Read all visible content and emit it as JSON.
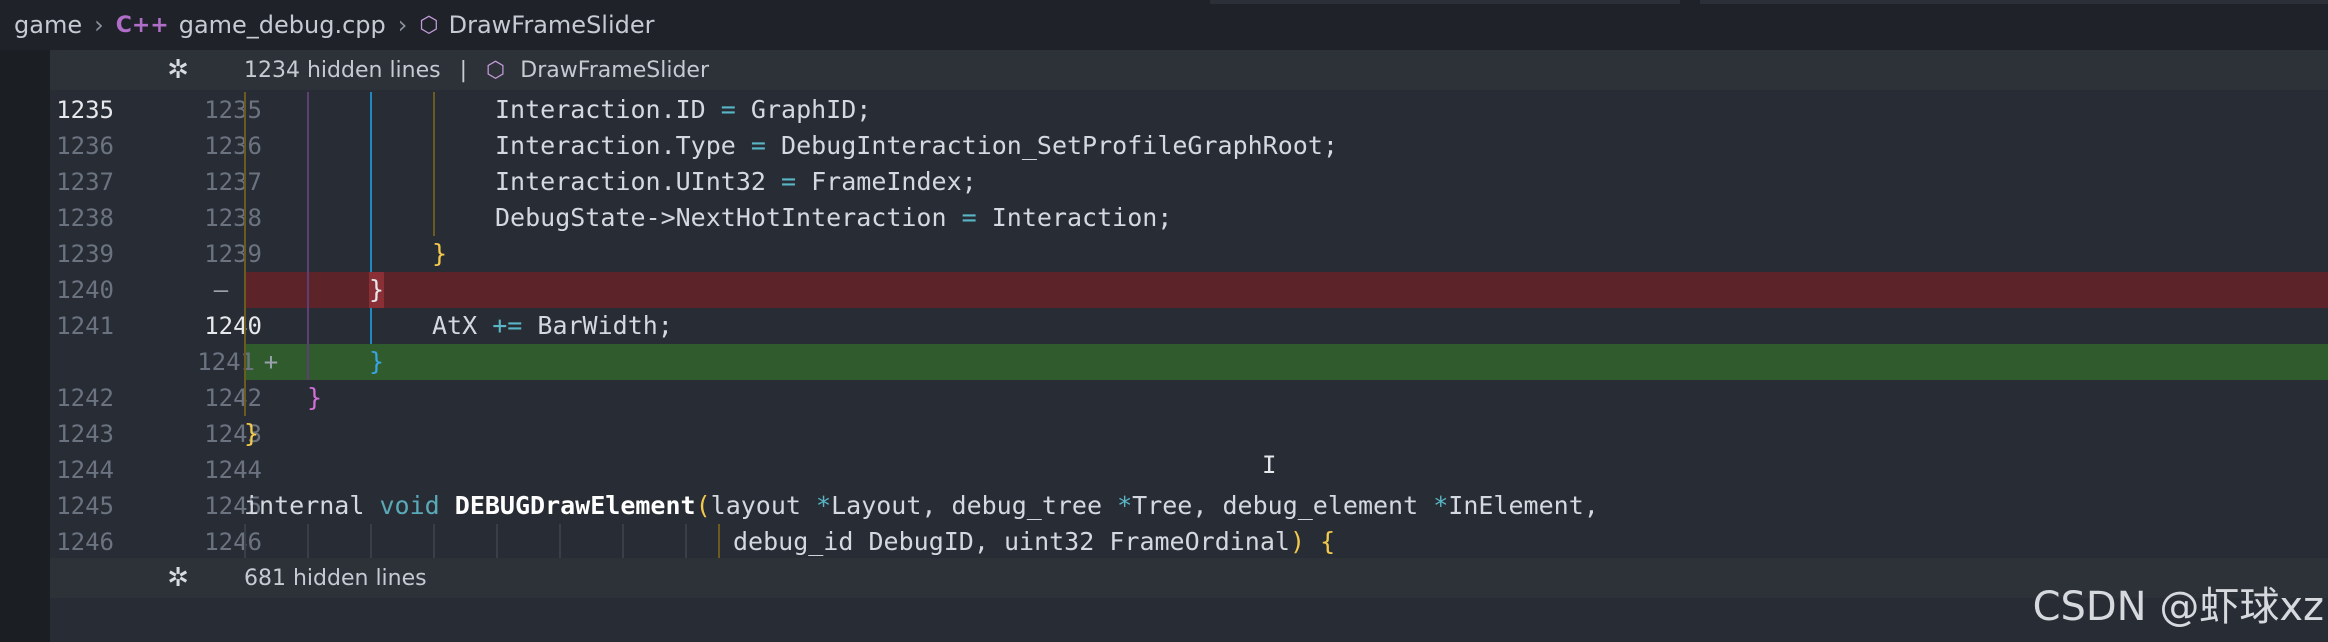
{
  "breadcrumb": {
    "folder": "game",
    "file_icon": "C++",
    "file": "game_debug.cpp",
    "symbol": "DrawFrameSlider"
  },
  "folds": {
    "top": {
      "text": "1234 hidden lines",
      "sep": "|",
      "symbol": "DrawFrameSlider"
    },
    "bottom": {
      "text": "681 hidden lines"
    }
  },
  "lines": [
    {
      "old": "1235",
      "new": "1235",
      "active": true
    },
    {
      "old": "1236",
      "new": "1236"
    },
    {
      "old": "1237",
      "new": "1237"
    },
    {
      "old": "1238",
      "new": "1238"
    },
    {
      "old": "1239",
      "new": "1239"
    },
    {
      "old": "1240",
      "new": "",
      "marker": "—"
    },
    {
      "old": "1241",
      "new": "1240",
      "active_new": true
    },
    {
      "old": "",
      "new": "1241",
      "marker": "+"
    },
    {
      "old": "1242",
      "new": "1242"
    },
    {
      "old": "1243",
      "new": "1243"
    },
    {
      "old": "1244",
      "new": "1244"
    },
    {
      "old": "1245",
      "new": "1245"
    },
    {
      "old": "1246",
      "new": "1246"
    }
  ],
  "code": {
    "l1235": {
      "obj": "Interaction",
      "field": ".ID",
      "eq": "=",
      "val": "GraphID;"
    },
    "l1236": {
      "obj": "Interaction",
      "field": ".Type",
      "eq": "=",
      "val": "DebugInteraction_SetProfileGraphRoot;"
    },
    "l1237": {
      "obj": "Interaction",
      "field": ".UInt32",
      "eq": "=",
      "val": "FrameIndex;"
    },
    "l1238": {
      "obj": "DebugState->NextHotInteraction",
      "eq": "=",
      "val": "Interaction;"
    },
    "l1239": {
      "brace": "}"
    },
    "l1240_removed": {
      "brace": "}"
    },
    "l1241": {
      "lhs": "AtX",
      "op": "+=",
      "rhs": "BarWidth;"
    },
    "l1241_added": {
      "brace": "}"
    },
    "l1242": {
      "brace": "}"
    },
    "l1243": {
      "brace": "}"
    },
    "l1245": {
      "kw1": "internal",
      "kw2": "void",
      "fn": "DEBUGDrawElement",
      "paren": "(",
      "t1": "layout",
      "star1": "*",
      "p1": "Layout,",
      "t2": "debug_tree",
      "star2": "*",
      "p2": "Tree,",
      "t3": "debug_element",
      "star3": "*",
      "p3": "InElement,"
    },
    "l1246": {
      "t4": "debug_id",
      "p4": "DebugID,",
      "t5": "uint32",
      "p5": "FrameOrdinal",
      "close": ")",
      "open": "{"
    }
  },
  "icons": {
    "unfold": "✲",
    "cube": "⬡",
    "ibeam": "I"
  },
  "watermark": "CSDN @虾球xz",
  "colors": {
    "removed_bg": "#5c2429",
    "added_bg": "#2f5b2d",
    "editor_bg": "#282c34"
  }
}
